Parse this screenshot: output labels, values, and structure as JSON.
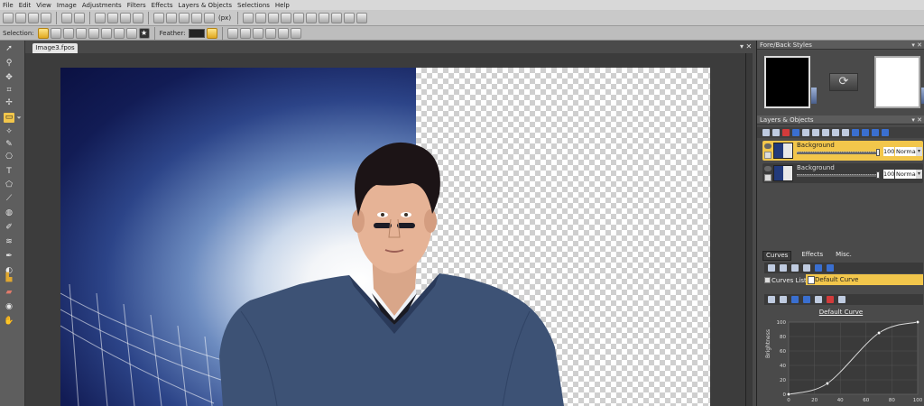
{
  "menu": [
    "File",
    "Edit",
    "View",
    "Image",
    "Adjustments",
    "Filters",
    "Effects",
    "Layers & Objects",
    "Selections",
    "Help"
  ],
  "toolbar1": {
    "units_label": "(px)"
  },
  "toolbar2": {
    "selection_label": "Selection:",
    "feather_label": "Feather:"
  },
  "document": {
    "tab_title": "Image3.fpos"
  },
  "fore_back": {
    "title": "Fore/Back Styles",
    "foreground_color": "#000000",
    "background_color": "#ffffff"
  },
  "layers_panel": {
    "title": "Layers & Objects",
    "layers": [
      {
        "name": "Background",
        "opacity": "100",
        "mode": "Normal",
        "selected": true
      },
      {
        "name": "Background",
        "opacity": "100",
        "mode": "Normal",
        "selected": false
      }
    ]
  },
  "curves_panel": {
    "tabs": [
      "Curves",
      "Effects",
      "Misc."
    ],
    "list_label": "Curves List:",
    "selected_curve": "Default Curve",
    "curve_title": "Default Curve",
    "y_axis_label": "Brightness",
    "chart_data": {
      "type": "line",
      "title": "Default Curve",
      "ylabel": "Brightness",
      "xlabel": "",
      "x_ticks": [
        0,
        20,
        40,
        60,
        80,
        100
      ],
      "y_ticks": [
        0,
        20,
        40,
        60,
        80,
        100
      ],
      "xlim": [
        0,
        100
      ],
      "ylim": [
        0,
        100
      ],
      "control_points": [
        [
          0,
          0
        ],
        [
          30,
          15
        ],
        [
          70,
          85
        ],
        [
          100,
          100
        ]
      ],
      "grid": true
    }
  },
  "colors": {
    "accent": "#f2c64b",
    "panel_bg": "#4a4a4a",
    "workspace_bg": "#3c3c3c"
  },
  "icons": [
    "pointer-icon",
    "zoom-icon",
    "move-icon",
    "crop-icon",
    "rect-select-icon",
    "brush-icon",
    "text-icon",
    "eyedropper-icon",
    "eraser-icon",
    "clone-icon",
    "swap-icon"
  ]
}
